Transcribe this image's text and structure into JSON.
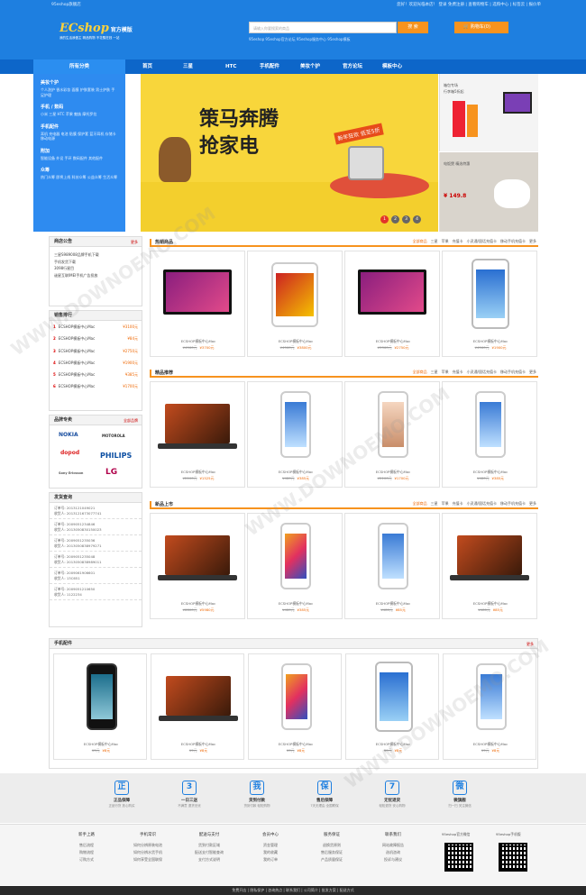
{
  "topbar": {
    "left": "95eshop旗舰店",
    "right": "您好！欢迎光临本店！  登录  免费注册  |  查看购物车  |  选购中心  |  标签云  |  报价单"
  },
  "header": {
    "logo": "ECshop",
    "logo_sub": "官方模版",
    "slogan": "我的生活我做主  精品购物  不花冤枉钱  一站",
    "search_placeholder": "请输入你要搜索的商品",
    "search_button": "搜 索",
    "hotwords": "95eshop  95eshop官方论坛  95eshop服务中心  95eshop模板",
    "cart": "购物车(0)"
  },
  "nav": {
    "category_label": "所有分类",
    "items": [
      "首页",
      "三星",
      "HTC",
      "手机配件",
      "美妆个护",
      "官方论坛",
      "模板中心"
    ]
  },
  "sidemenu": [
    {
      "title": "美妆个护",
      "items": "个人洗护  香水彩妆  面膜  护肤套装  男士护肤  手足护理"
    },
    {
      "title": "手机 / 数码",
      "items": "小米  三星  HTC  苹果  魅族  摩托罗拉"
    },
    {
      "title": "手机配件",
      "items": "耳机  充电器  电池  贴膜  保护套  蓝牙耳机  存储卡  移动电源"
    },
    {
      "title": "附加",
      "items": "智能设备  外设  手环  数码配件  其他配件"
    },
    {
      "title": "众筹",
      "items": "热门众筹  即将上线  科技众筹  公益众筹  生活众筹"
    }
  ],
  "banner": {
    "title_line1": "策马奔腾",
    "title_line2": "抢家电",
    "tag": "新年狂欢 低至5折",
    "dots": [
      "1",
      "2",
      "3",
      "4"
    ]
  },
  "right_banners": [
    {
      "title": "箱包专场",
      "sub": "行李箱5折起"
    },
    {
      "title": "电饭煲 精选特惠",
      "sub": "¥ 149.8"
    }
  ],
  "notice": {
    "title": "商店公告",
    "more": "更多",
    "items": [
      "三星S989008品牌手机下载",
      "手机发货下载",
      "3098行星目",
      "谜星互联IMEI手机广告投放"
    ]
  },
  "ranking": {
    "title": "销售排行",
    "items": [
      {
        "n": "1",
        "name": "ECSHOP模板中心Mac",
        "price": "¥3100元"
      },
      {
        "n": "2",
        "name": "ECSHOP模板中心Mac",
        "price": "¥84元"
      },
      {
        "n": "3",
        "name": "ECSHOP模板中心Mac",
        "price": "¥2750元"
      },
      {
        "n": "4",
        "name": "ECSHOP模板中心Mac",
        "price": "¥1900元"
      },
      {
        "n": "5",
        "name": "ECSHOP模板中心Mac",
        "price": "¥385元"
      },
      {
        "n": "6",
        "name": "ECSHOP模板中心Mac",
        "price": "¥1700元"
      }
    ]
  },
  "brands": {
    "title": "品牌专卖",
    "more": "全部品牌",
    "items": [
      "NOKIA",
      "MOTOROLA",
      "dopod",
      "PHILIPS",
      "Sony Ericsson",
      "LG"
    ]
  },
  "orders": {
    "title": "发货查询",
    "items": [
      "订单号: 2013121049021\n收货人: 2013121673077741",
      "订单号: 2009051234846\n收货人: 2013050830150023",
      "订单号: 2009051235036\n收货人: 2013050838979271",
      "订单号: 2009051235048\n收货人: 2013050838989011",
      "订单号: 2009061906601\n收货人: 13C651",
      "订单号: 2009051210650\n收货人: 1122234"
    ]
  },
  "sections": [
    {
      "title": "热销商品",
      "tabs": [
        "全部商品",
        "三星",
        "苹果",
        "充值卡",
        "小灵通/固话充值卡",
        "移动手机充值卡",
        "更多"
      ]
    },
    {
      "title": "精品推荐",
      "tabs": [
        "全部商品",
        "三星",
        "苹果",
        "充值卡",
        "小灵通/固话充值卡",
        "移动手机充值卡",
        "更多"
      ]
    },
    {
      "title": "新品上市",
      "tabs": [
        "全部商品",
        "三星",
        "苹果",
        "充值卡",
        "小灵通/固话充值卡",
        "移动手机充值卡",
        "更多"
      ]
    }
  ],
  "product_name": "ECSHOP模板中心Mac",
  "products": [
    [
      {
        "old": "¥4560元",
        "new": "¥3700元"
      },
      {
        "old": "¥4560元",
        "new": "¥3800元"
      },
      {
        "old": "¥3360元",
        "new": "¥2750元"
      },
      {
        "old": "¥4560元",
        "new": "¥1900元"
      }
    ],
    [
      {
        "old": "¥2100元",
        "new": "¥1525元"
      },
      {
        "old": "¥480元",
        "new": "¥385元"
      },
      {
        "old": "¥2100元",
        "new": "¥1700元"
      },
      {
        "old": "¥480元",
        "new": "¥385元"
      }
    ],
    [
      {
        "old": "¥8800元",
        "new": "¥5980元"
      },
      {
        "old": "¥480元",
        "new": "¥385元"
      },
      {
        "old": "¥480元",
        "new": "¥85元"
      },
      {
        "old": "¥480元",
        "new": "¥85元"
      }
    ]
  ],
  "accessories": {
    "title": "手机配件",
    "more": "更多",
    "items": [
      {
        "old": "¥9元",
        "new": "¥8元"
      },
      {
        "old": "¥9元",
        "new": "¥8元"
      },
      {
        "old": "¥9元",
        "new": "¥8元"
      },
      {
        "old": "¥9元",
        "new": "¥8元"
      },
      {
        "old": "¥9元",
        "new": "¥8元"
      }
    ]
  },
  "services": [
    {
      "icon": "正",
      "title": "正品保障",
      "sub": "正品行货  放心购买"
    },
    {
      "icon": "3",
      "title": "一日三送",
      "sub": "不满意  退货无忧"
    },
    {
      "icon": "我",
      "title": "货到付款",
      "sub": "货到付款  轻松购物"
    },
    {
      "icon": "保",
      "title": "售后保障",
      "sub": "7天无理由  全国联保"
    },
    {
      "icon": "7",
      "title": "无忧退货",
      "sub": "轻松退货  安心购物"
    },
    {
      "icon": "微",
      "title": "微旗舰",
      "sub": "扫一扫  关注微信"
    }
  ],
  "footer": {
    "columns": [
      {
        "title": "新手上路",
        "items": [
          "售后流程",
          "购物流程",
          "订购方式"
        ]
      },
      {
        "title": "手机常识",
        "items": [
          "如何分辨原装电池",
          "如何分辨水货手机",
          "如何享受全国联保"
        ]
      },
      {
        "title": "配送与支付",
        "items": [
          "货到付款区域",
          "配送支付智能查询",
          "支付方式说明"
        ]
      },
      {
        "title": "会员中心",
        "items": [
          "资金管理",
          "我的收藏",
          "我的订单"
        ]
      },
      {
        "title": "服务保证",
        "items": [
          "退换货原则",
          "售后服务保证",
          "产品质量保证"
        ]
      },
      {
        "title": "联系我们",
        "items": [
          "网站故障报告",
          "选机咨询",
          "投诉与建议"
        ]
      }
    ],
    "qr_labels": [
      "95eshop官方微信",
      "95eshop手机版"
    ]
  },
  "bottombar": "免费开店  |  隐私保护  |  咨询热点  |  联系我们  |  公司简介  |  批发方案  |  配送方式",
  "watermark": "WWW.DOWNOEMO.COM"
}
